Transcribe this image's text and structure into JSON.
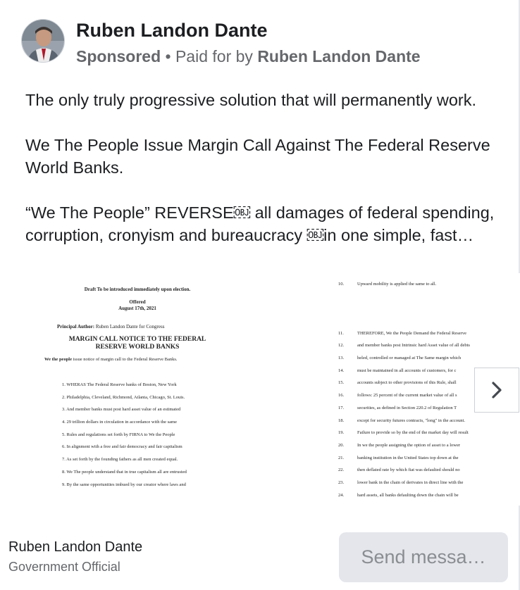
{
  "advertiser": {
    "name": "Ruben Landon Dante",
    "sponsored_label": "Sponsored",
    "separator": " • ",
    "paid_for_prefix": "Paid for by ",
    "paid_for_name": "Ruben Landon Dante"
  },
  "body": {
    "paragraphs": [
      "The only truly progressive solution that will permanently work.",
      "We The People Issue Margin Call Against The Federal Reserve World Banks.",
      "“We The People” REVERSE￼ all damages of federal spending, corruption, cronyism and bureaucracy ￼in one simple, fast…"
    ]
  },
  "carousel": {
    "card1": {
      "draft_line": "Draft To be introduced immediately upon election.",
      "offered": "Offered",
      "date": "August 17th, 2021",
      "author_label": "Principal Author:",
      "author_value": " Ruben Landon Dante for Congress",
      "title_line1": "MARGIN CALL NOTICE TO THE FEDERAL",
      "title_line2": "RESERVE WORLD BANKS",
      "intro_bold": "We the people",
      "intro_rest": " issue notice of margin call to the Federal Reserve Banks.",
      "items": [
        "1. WHERAS The Federal Reserve banks of Boston, New York",
        "2. Philadelphia, Cleveland, Richmond, Atlanta, Chicago, St. Louis.",
        "3. And member banks must post hard asset value of an estimated",
        "4. 29 trillion dollars in circulation in accordance with the same",
        "5. Rules and regulations set forth by FIRNA to We the People",
        "6. In alignment with a free and fair democracy and fair capitalism",
        "7. As set forth by the founding fathers as all men created equal.",
        "8. We The people understand that in true capitalism all are entrusted",
        "9. By the same opportunities imbued by our creator where laws and"
      ]
    },
    "card2": {
      "items": [
        {
          "n": "10.",
          "t": "Upward mobility is applied the same to all."
        },
        {
          "n": "11.",
          "t": "THEREFORE, We the People Demand the Federal Reserve"
        },
        {
          "n": "12.",
          "t": "and member banks post Intrinsic hard Asset value of all debts"
        },
        {
          "n": "13.",
          "t": "heled, controlled or managed at The Same margin which"
        },
        {
          "n": "14.",
          "t": "must be maintained in all accounts of customers, for c"
        },
        {
          "n": "15.",
          "t": "accounts subject to other provisions of this Rule, shall"
        },
        {
          "n": "16.",
          "t": "follows: 25 percent of the current market value of all s"
        },
        {
          "n": "17.",
          "t": "securities, as defined in Section 220.2 of Regulation T"
        },
        {
          "n": "18.",
          "t": "except for security futures contracts, \"long\" in the account."
        },
        {
          "n": "19.",
          "t": "Failure to provide so by the end of the market day will result"
        },
        {
          "n": "20.",
          "t": "In we the people assigning the option of asset to a lower"
        },
        {
          "n": "21.",
          "t": "banking institution in the United States top down at the"
        },
        {
          "n": "22.",
          "t": "then deflated rate by which fiat was defaulted should no"
        },
        {
          "n": "23.",
          "t": "lower bank in the chain of derivates in direct line with the"
        },
        {
          "n": "24.",
          "t": "hard assets, all banks defaulting down the chain will be"
        }
      ]
    },
    "next_icon": "chevron-right-icon"
  },
  "footer": {
    "page_name": "Ruben Landon Dante",
    "page_category": "Government Official",
    "cta_label": "Send messa…"
  },
  "colors": {
    "primary_text": "#1c1e21",
    "secondary_text": "#65676b",
    "button_bg": "#e4e6eb",
    "button_text": "#8a8d91"
  }
}
